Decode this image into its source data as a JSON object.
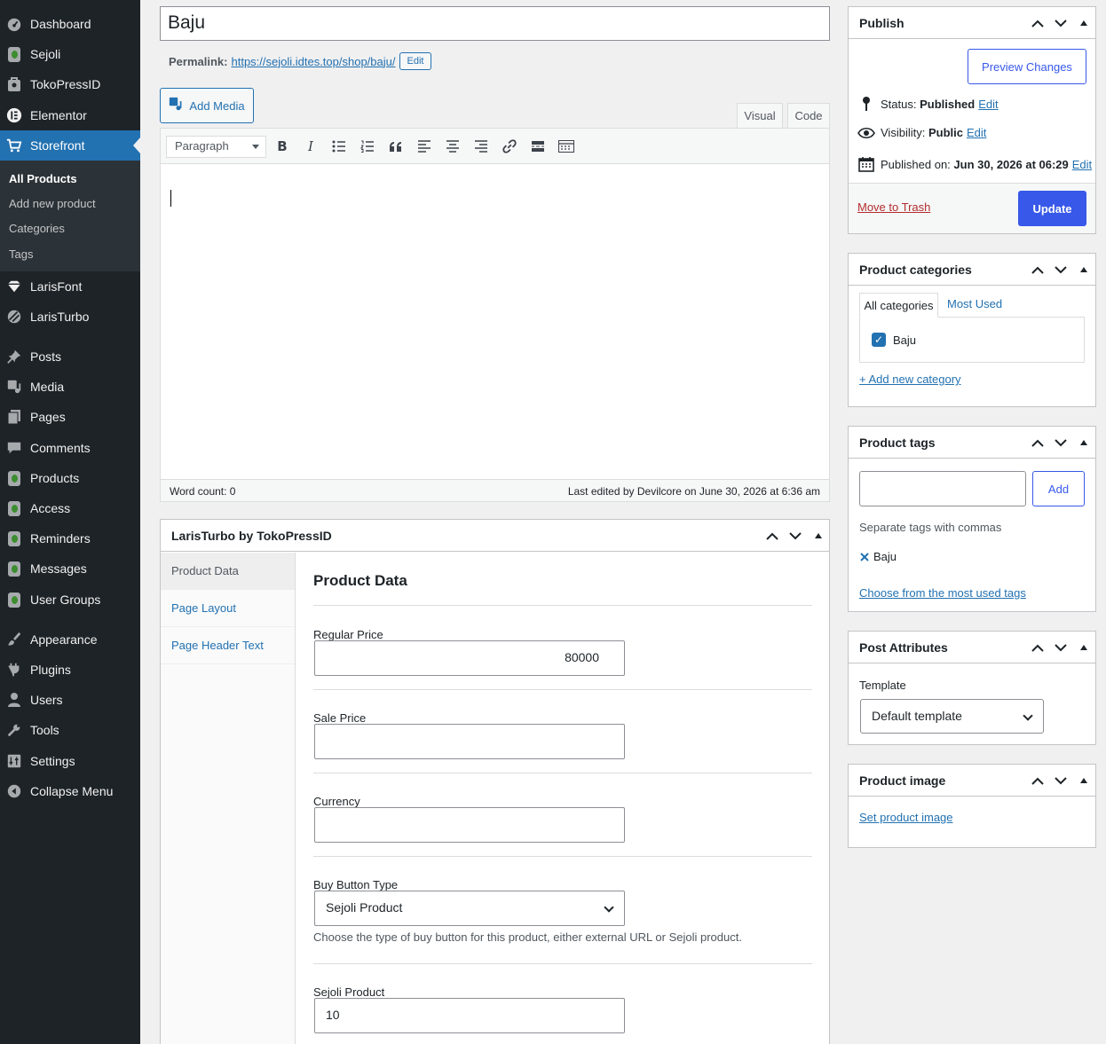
{
  "sidebar": {
    "items": [
      {
        "label": "Dashboard",
        "icon": "dashboard-icon"
      },
      {
        "label": "Sejoli",
        "icon": "sejoli-leaf-icon"
      },
      {
        "label": "TokoPressID",
        "icon": "tokopress-icon"
      },
      {
        "label": "Elementor",
        "icon": "elementor-icon"
      },
      {
        "label": "Storefront",
        "icon": "cart-icon"
      },
      {
        "label": "LarisFont",
        "icon": "diamond-icon"
      },
      {
        "label": "LarisTurbo",
        "icon": "turbo-icon"
      },
      {
        "label": "Posts",
        "icon": "pin-icon"
      },
      {
        "label": "Media",
        "icon": "media-icon"
      },
      {
        "label": "Pages",
        "icon": "pages-icon"
      },
      {
        "label": "Comments",
        "icon": "comments-icon"
      },
      {
        "label": "Products",
        "icon": "leaf-icon"
      },
      {
        "label": "Access",
        "icon": "leaf-icon"
      },
      {
        "label": "Reminders",
        "icon": "leaf-icon"
      },
      {
        "label": "Messages",
        "icon": "leaf-icon"
      },
      {
        "label": "User Groups",
        "icon": "leaf-icon"
      },
      {
        "label": "Appearance",
        "icon": "brush-icon"
      },
      {
        "label": "Plugins",
        "icon": "plug-icon"
      },
      {
        "label": "Users",
        "icon": "user-icon"
      },
      {
        "label": "Tools",
        "icon": "wrench-icon"
      },
      {
        "label": "Settings",
        "icon": "settings-icon"
      },
      {
        "label": "Collapse Menu",
        "icon": "collapse-icon"
      }
    ],
    "submenu": [
      "All Products",
      "Add new product",
      "Categories",
      "Tags"
    ]
  },
  "editor": {
    "title": "Baju",
    "permalink_label": "Permalink:",
    "permalink_url": "https://sejoli.idtes.top/shop/baju/",
    "permalink_edit": "Edit",
    "add_media": "Add Media",
    "tab_visual": "Visual",
    "tab_code": "Code",
    "format": "Paragraph",
    "word_count": "Word count: 0",
    "last_edited": "Last edited by Devilcore on June 30, 2026 at 6:36 am"
  },
  "laris": {
    "title": "LarisTurbo by TokoPressID",
    "tabs": [
      "Product Data",
      "Page Layout",
      "Page Header Text"
    ],
    "panel_title": "Product Data",
    "regular_price_label": "Regular Price",
    "regular_price": "80000",
    "sale_price_label": "Sale Price",
    "sale_price": "",
    "currency_label": "Currency",
    "currency": "",
    "buy_button_label": "Buy Button Type",
    "buy_button_value": "Sejoli Product",
    "buy_button_desc": "Choose the type of buy button for this product, either external URL or Sejoli product.",
    "sejoli_product_label": "Sejoli Product",
    "sejoli_product": "10"
  },
  "publish": {
    "title": "Publish",
    "preview": "Preview Changes",
    "status_label": "Status:",
    "status": "Published",
    "visibility_label": "Visibility:",
    "visibility": "Public",
    "published_label": "Published on:",
    "published_on": "Jun 30, 2026 at 06:29",
    "edit": "Edit",
    "trash": "Move to Trash",
    "update": "Update"
  },
  "categories": {
    "title": "Product categories",
    "tab_all": "All categories",
    "tab_most": "Most Used",
    "items": [
      "Baju"
    ],
    "add_new": "+ Add new category"
  },
  "tags": {
    "title": "Product tags",
    "input": "",
    "add": "Add",
    "hint": "Separate tags with commas",
    "items": [
      "Baju"
    ],
    "choose": "Choose from the most used tags"
  },
  "attributes": {
    "title": "Post Attributes",
    "template_label": "Template",
    "template_value": "Default template"
  },
  "image": {
    "title": "Product image",
    "set_link": "Set product image"
  },
  "colors": {
    "sidebar_bg": "#1d2327",
    "accent": "#2271b1",
    "primary_button": "#3858e9",
    "trash": "#b32d2e"
  }
}
